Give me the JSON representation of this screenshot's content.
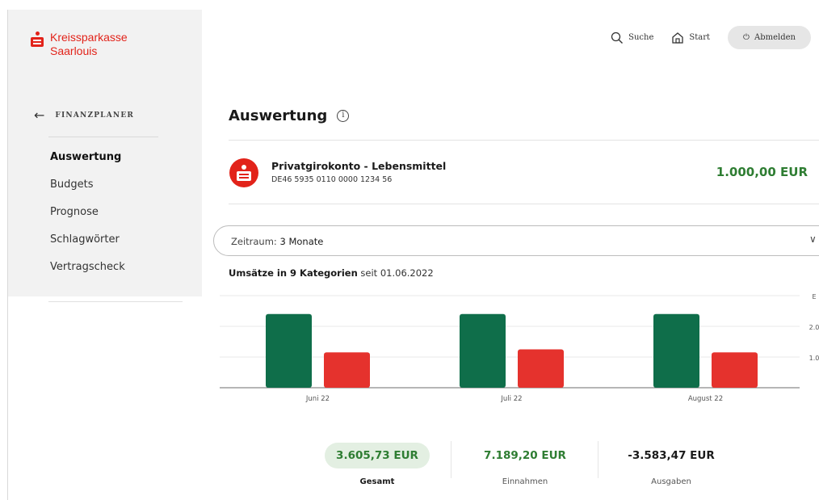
{
  "brand": {
    "line1": "Kreissparkasse",
    "line2": "Saarlouis",
    "color": "#e2231a"
  },
  "header": {
    "search_label": "Suche",
    "start_label": "Start",
    "logout_label": "Abmelden"
  },
  "sidebar": {
    "back_label": "FINANZPLANER",
    "items": [
      {
        "label": "Auswertung",
        "active": true
      },
      {
        "label": "Budgets",
        "active": false
      },
      {
        "label": "Prognose",
        "active": false
      },
      {
        "label": "Schlagwörter",
        "active": false
      },
      {
        "label": "Vertragscheck",
        "active": false
      }
    ]
  },
  "page": {
    "title": "Auswertung",
    "info_icon": "i"
  },
  "account": {
    "name": "Privatgirokonto - Lebensmittel",
    "iban": "DE46 5935 0110 0000 1234 56",
    "balance": "1.000,00 EUR"
  },
  "period": {
    "label": "Zeitraum:",
    "value": "3 Monate"
  },
  "chart_caption": {
    "strong": "Umsätze in 9 Kategorien",
    "rest": " seit 01.06.2022"
  },
  "chart_data": {
    "type": "bar",
    "categories": [
      "Juni 22",
      "Juli 22",
      "August 22"
    ],
    "series": [
      {
        "color": "#0f6e4a",
        "values": [
          2400,
          2400,
          2400
        ]
      },
      {
        "color": "#e5322d",
        "values": [
          1150,
          1250,
          1150
        ]
      }
    ],
    "ylim": [
      0,
      3000
    ],
    "ytick_labels": [
      {
        "value": 3000,
        "label": "E"
      },
      {
        "value": 2000,
        "label": "2.0"
      },
      {
        "value": 1000,
        "label": "1.0"
      }
    ],
    "grid": true
  },
  "totals": {
    "gesamt": {
      "value": "3.605,73 EUR",
      "label": "Gesamt"
    },
    "einnahmen": {
      "value": "7.189,20 EUR",
      "label": "Einnahmen"
    },
    "ausgaben": {
      "value": "-3.583,47 EUR",
      "label": "Ausgaben"
    }
  },
  "colors": {
    "positive": "#2e7d32",
    "income_bar": "#0f6e4a",
    "expense_bar": "#e5322d"
  }
}
